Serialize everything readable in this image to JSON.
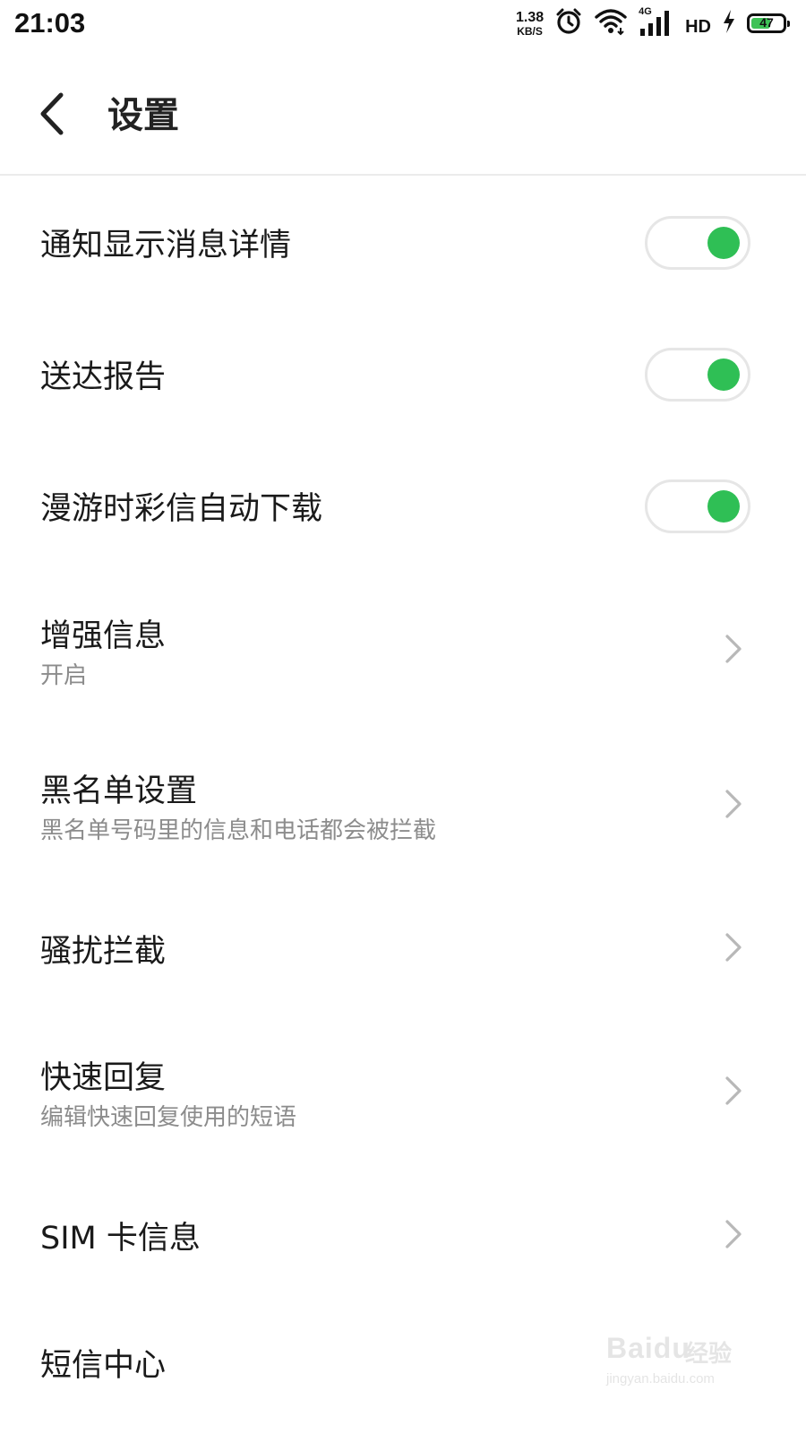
{
  "status_bar": {
    "time": "21:03",
    "net_speed_value": "1.38",
    "net_speed_unit": "KB/S",
    "icons": [
      "alarm-icon",
      "wifi-icon",
      "cellular-4g-icon",
      "hd-voice-icon",
      "charging-icon",
      "battery-icon"
    ],
    "signal_label": "4G",
    "hd_label": "HD",
    "battery_level": "47",
    "battery_percent": 47,
    "battery_color": "#3ec256"
  },
  "header": {
    "title": "设置",
    "back_icon": "chevron-left-icon"
  },
  "colors": {
    "accent_green": "#2fbf55",
    "subtitle_gray": "#8c8c8c",
    "divider": "#ebebeb"
  },
  "settings": [
    {
      "title": "通知显示消息详情",
      "type": "toggle",
      "enabled": true
    },
    {
      "title": "送达报告",
      "type": "toggle",
      "enabled": true
    },
    {
      "title": "漫游时彩信自动下载",
      "type": "toggle",
      "enabled": true
    },
    {
      "title": "增强信息",
      "subtitle": "开启",
      "type": "link"
    },
    {
      "title": "黑名单设置",
      "subtitle": "黑名单号码里的信息和电话都会被拦截",
      "type": "link"
    },
    {
      "title": "骚扰拦截",
      "type": "link"
    },
    {
      "title": "快速回复",
      "subtitle": "编辑快速回复使用的短语",
      "type": "link"
    },
    {
      "title": "SIM 卡信息",
      "type": "link"
    },
    {
      "title": "短信中心",
      "type": "link"
    }
  ],
  "watermark": {
    "brand": "Baidu",
    "product": "经验",
    "url": "jingyan.baidu.com"
  }
}
